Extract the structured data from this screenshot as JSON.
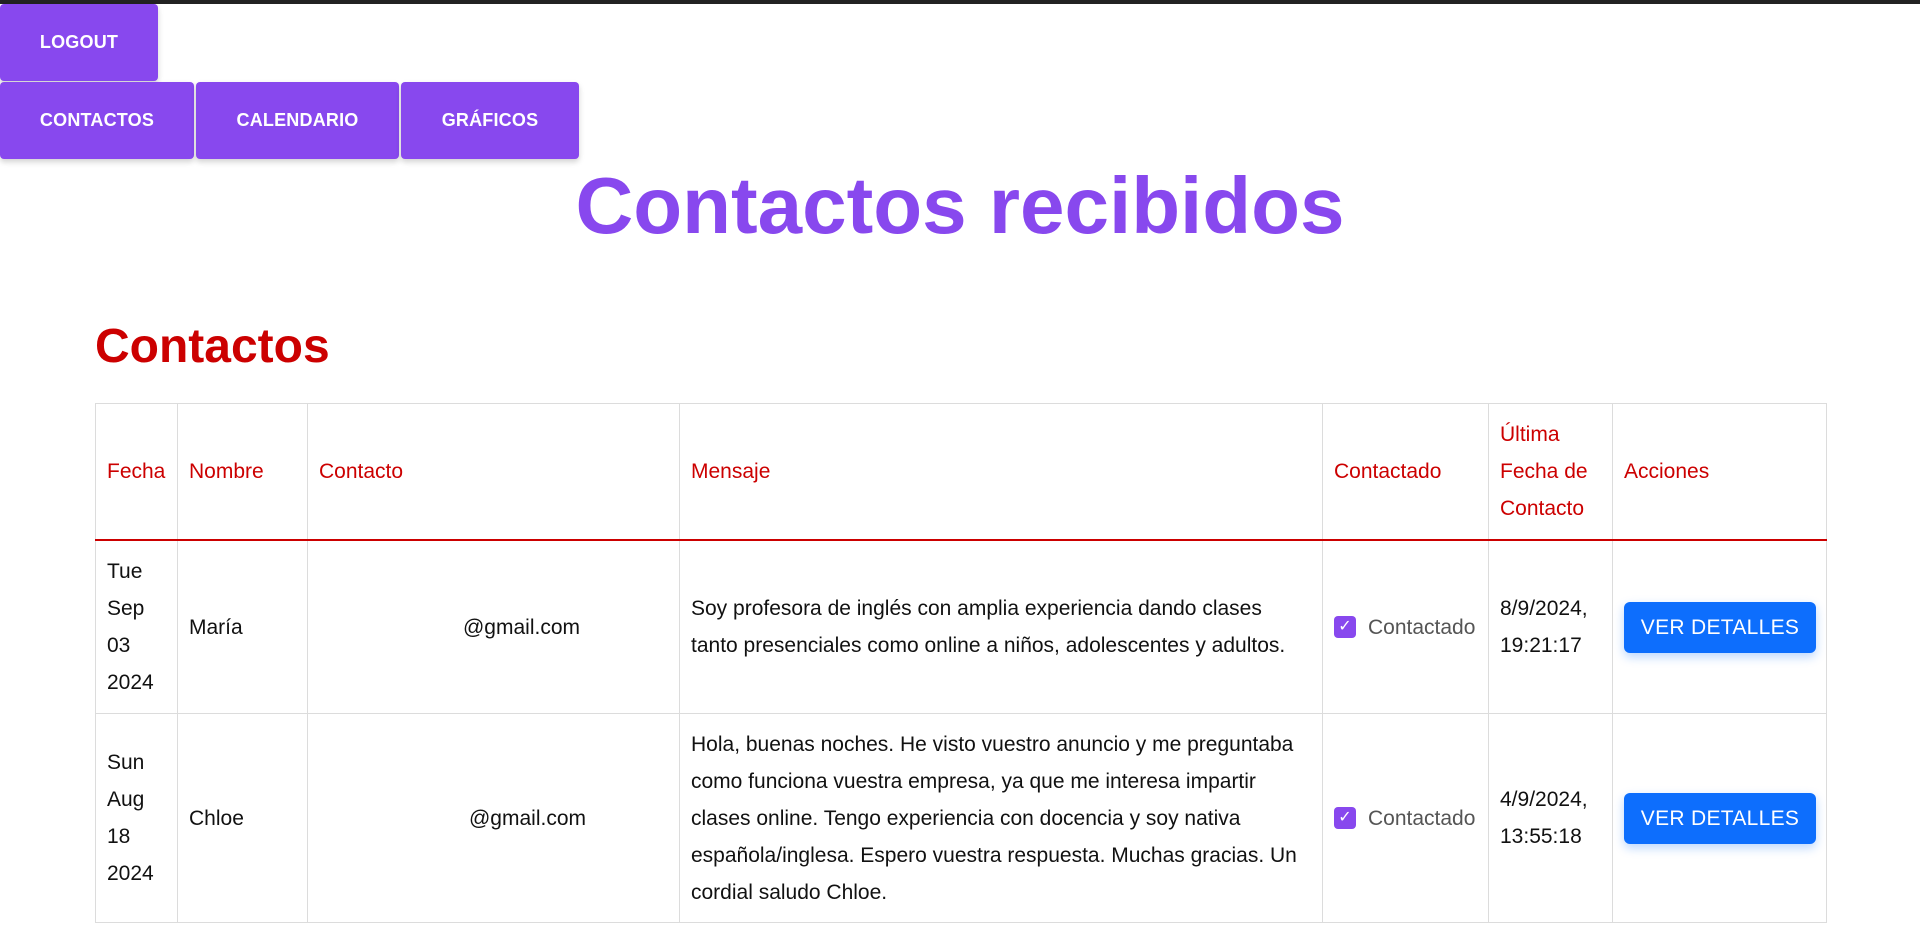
{
  "nav": {
    "logout": "LOGOUT",
    "contactos": "CONTACTOS",
    "calendario": "CALENDARIO",
    "graficos": "GRÁFICOS"
  },
  "page_title": "Contactos recibidos",
  "section_title": "Contactos",
  "table": {
    "headers": [
      "Fecha",
      "Nombre",
      "Contacto",
      "Mensaje",
      "Contactado",
      "Última Fecha de Contacto",
      "Acciones"
    ],
    "rows": [
      {
        "fecha": "Tue Sep 03 2024",
        "nombre": "María",
        "contacto": "@gmail.com",
        "mensaje": "Soy profesora de inglés con amplia experiencia dando clases tanto presenciales como online a niños, adolescentes y adultos.",
        "contactado_label": "Contactado",
        "contactado_checked": true,
        "ultima_fecha": "8/9/2024, 19:21:17",
        "accion": "VER DETALLES"
      },
      {
        "fecha": "Sun Aug 18 2024",
        "nombre": "Chloe",
        "contacto": "@gmail.com",
        "mensaje": "Hola, buenas noches. He visto vuestro anuncio y me preguntaba como funciona vuestra empresa, ya que me interesa impartir clases online. Tengo experiencia con docencia y soy nativa española/inglesa. Espero vuestra respuesta. Muchas gracias. Un cordial saludo Chloe.",
        "contactado_label": "Contactado",
        "contactado_checked": true,
        "ultima_fecha": "4/9/2024, 13:55:18",
        "accion": "VER DETALLES"
      }
    ]
  },
  "colors": {
    "accent": "#8848ee",
    "section": "#cc0000",
    "button": "#0d6efd"
  }
}
